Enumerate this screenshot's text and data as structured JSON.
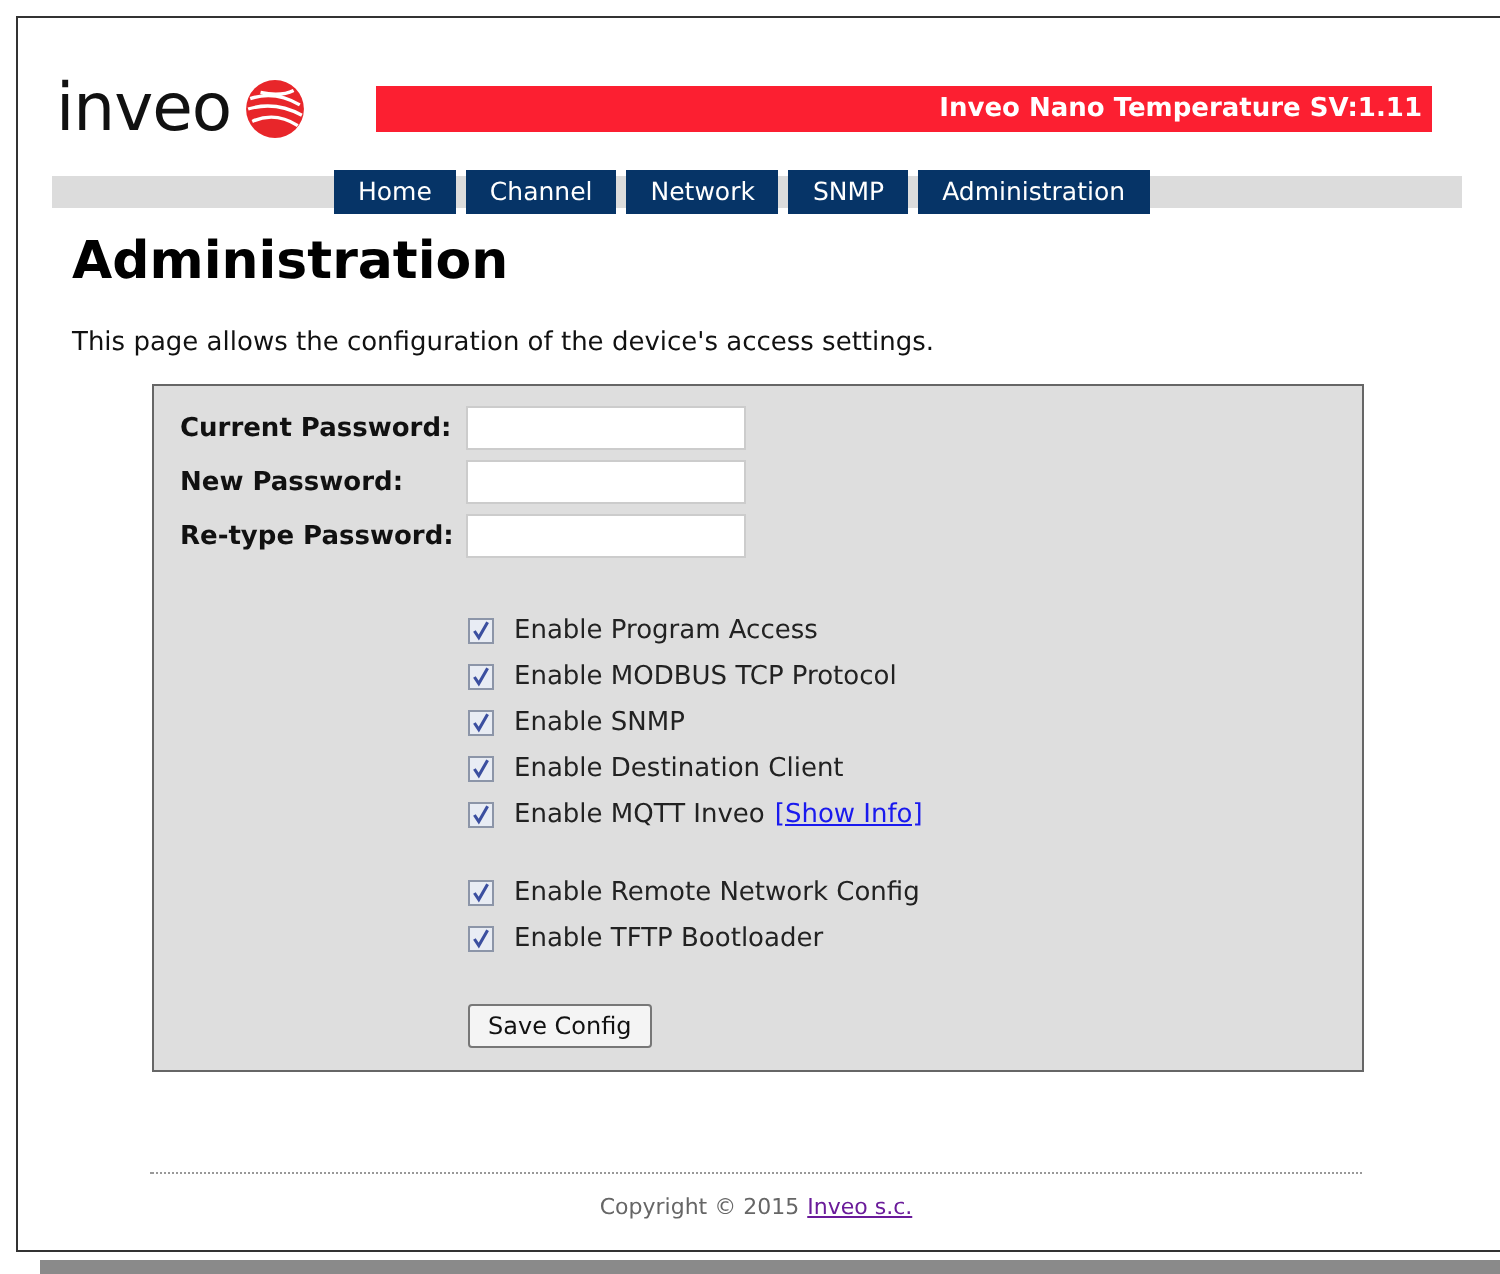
{
  "logo": {
    "text": "inveo"
  },
  "banner": {
    "title": "Inveo Nano Temperature SV:1.11"
  },
  "nav": [
    {
      "label": "Home"
    },
    {
      "label": "Channel"
    },
    {
      "label": "Network"
    },
    {
      "label": "SNMP"
    },
    {
      "label": "Administration"
    }
  ],
  "heading": "Administration",
  "description": "This page allows the configuration of the device's access settings.",
  "fields": [
    {
      "label": "Current Password:"
    },
    {
      "label": "New Password:"
    },
    {
      "label": "Re-type Password:"
    }
  ],
  "option_groups": [
    [
      {
        "label": "Enable Program Access",
        "checked": true
      },
      {
        "label": "Enable MODBUS TCP Protocol",
        "checked": true
      },
      {
        "label": "Enable SNMP",
        "checked": true
      },
      {
        "label": "Enable Destination Client",
        "checked": true
      },
      {
        "label": "Enable MQTT Inveo",
        "checked": true,
        "link": "[Show Info]"
      }
    ],
    [
      {
        "label": "Enable Remote Network Config",
        "checked": true
      },
      {
        "label": "Enable TFTP Bootloader",
        "checked": true
      }
    ]
  ],
  "save_button": "Save Config",
  "footer": {
    "text": "Copyright © 2015",
    "link": "Inveo s.c."
  }
}
